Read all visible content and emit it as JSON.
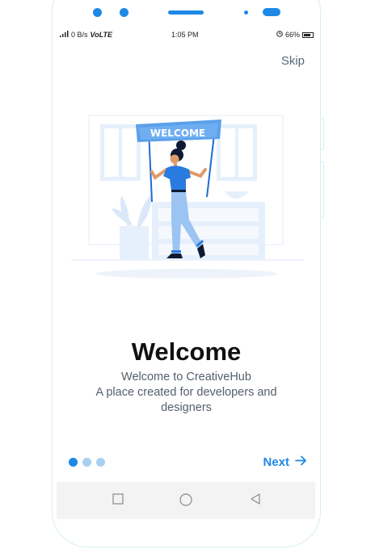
{
  "status_bar": {
    "network_speed": "0 B/s",
    "network_type": "VoLTE",
    "time": "1:05 PM",
    "battery": "66%",
    "icons": [
      "signal-icon",
      "wifi-icon",
      "battery-icon",
      "alarm-icon"
    ]
  },
  "onboarding": {
    "skip_label": "Skip",
    "banner_text": "WELCOME",
    "title": "Welcome",
    "subtitle_line1": "Welcome to CreativeHub",
    "subtitle_line2": "A place created for developers and",
    "subtitle_line3": "designers",
    "next_label": "Next",
    "page_count": 3,
    "active_page": 1
  },
  "navigation_bar": {
    "icons": [
      "recent-apps-icon",
      "home-icon",
      "back-icon"
    ]
  },
  "colors": {
    "accent": "#1e88e5",
    "inactive_dot": "#a9cff3",
    "illustration_light": "#e6f0fc"
  }
}
